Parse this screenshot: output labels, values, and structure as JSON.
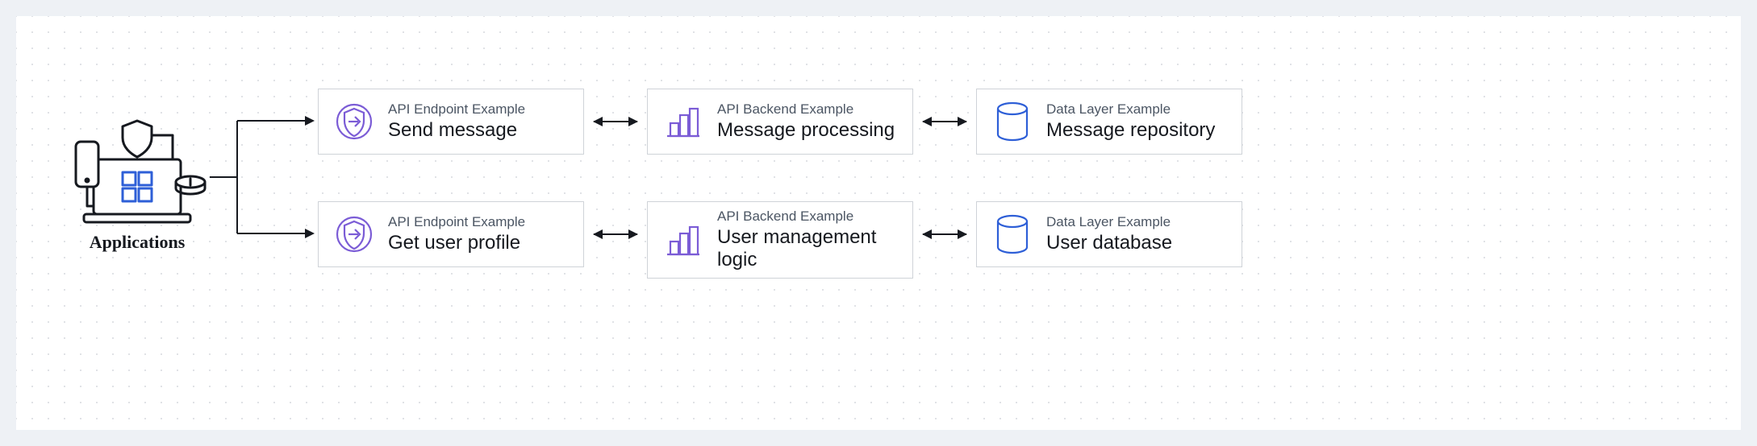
{
  "diagram": {
    "applications_label": "Applications",
    "rows": [
      {
        "endpoint": {
          "subtitle": "API Endpoint Example",
          "title": "Send message"
        },
        "backend": {
          "subtitle": "API Backend Example",
          "title": "Message processing"
        },
        "data": {
          "subtitle": "Data Layer Example",
          "title": "Message repository"
        }
      },
      {
        "endpoint": {
          "subtitle": "API Endpoint Example",
          "title": "Get user profile"
        },
        "backend": {
          "subtitle": "API Backend Example",
          "title": "User management logic"
        },
        "data": {
          "subtitle": "Data Layer Example",
          "title": "User database"
        }
      }
    ]
  },
  "colors": {
    "endpoint_icon": "#7b5cd6",
    "backend_icon": "#7b5cd6",
    "data_icon": "#2e5fd7",
    "stroke": "#16191f"
  }
}
